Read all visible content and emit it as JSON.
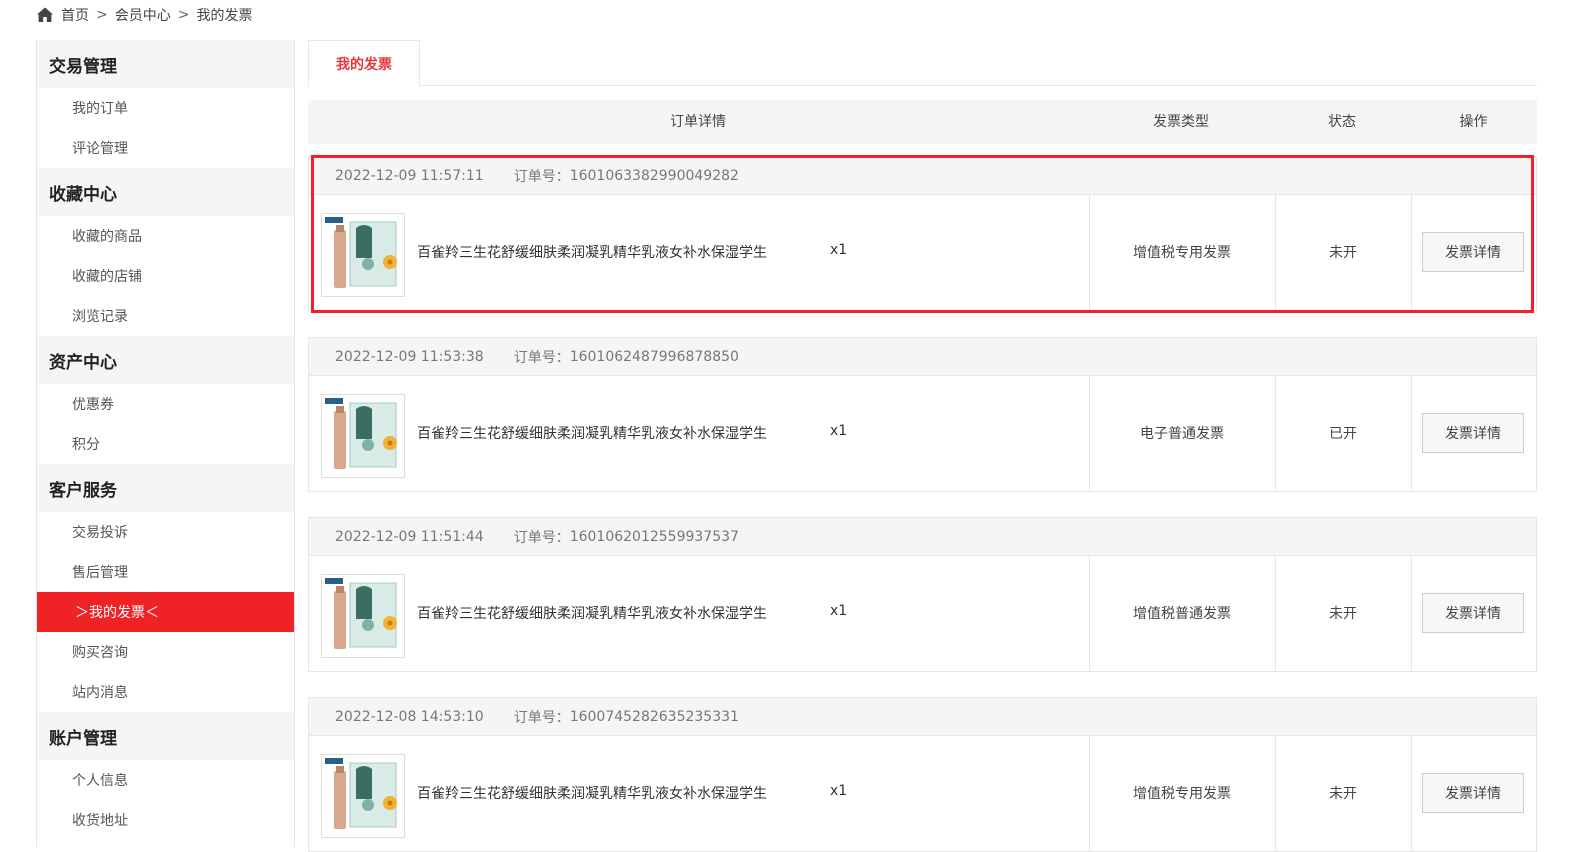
{
  "breadcrumb": {
    "home": "首页",
    "sep": ">",
    "member": "会员中心",
    "current": "我的发票"
  },
  "sidebar": {
    "groups": [
      {
        "title": "交易管理",
        "items": [
          "我的订单",
          "评论管理"
        ]
      },
      {
        "title": "收藏中心",
        "items": [
          "收藏的商品",
          "收藏的店铺",
          "浏览记录"
        ]
      },
      {
        "title": "资产中心",
        "items": [
          "优惠券",
          "积分"
        ]
      },
      {
        "title": "客户服务",
        "items": [
          "交易投诉",
          "售后管理",
          "＞我的发票＜",
          "购买咨询",
          "站内消息"
        ]
      },
      {
        "title": "账户管理",
        "items": [
          "个人信息",
          "收货地址"
        ]
      }
    ]
  },
  "tabs": {
    "active": "我的发票"
  },
  "table": {
    "headers": {
      "detail": "订单详情",
      "type": "发票类型",
      "status": "状态",
      "action": "操作"
    }
  },
  "orders": [
    {
      "date": "2022-12-09 11:57:11",
      "order_label": "订单号：",
      "order_no": "1601063382990049282",
      "product": "百雀羚三生花舒缓细肤柔润凝乳精华乳液女补水保湿学生",
      "qty": "x1",
      "invoice_type": "增值税专用发票",
      "status": "未开",
      "action": "发票详情"
    },
    {
      "date": "2022-12-09 11:53:38",
      "order_label": "订单号：",
      "order_no": "1601062487996878850",
      "product": "百雀羚三生花舒缓细肤柔润凝乳精华乳液女补水保湿学生",
      "qty": "x1",
      "invoice_type": "电子普通发票",
      "status": "已开",
      "action": "发票详情"
    },
    {
      "date": "2022-12-09 11:51:44",
      "order_label": "订单号：",
      "order_no": "1601062012559937537",
      "product": "百雀羚三生花舒缓细肤柔润凝乳精华乳液女补水保湿学生",
      "qty": "x1",
      "invoice_type": "增值税普通发票",
      "status": "未开",
      "action": "发票详情"
    },
    {
      "date": "2022-12-08 14:53:10",
      "order_label": "订单号：",
      "order_no": "1600745282635235331",
      "product": "百雀羚三生花舒缓细肤柔润凝乳精华乳液女补水保湿学生",
      "qty": "x1",
      "invoice_type": "增值税专用发票",
      "status": "未开",
      "action": "发票详情"
    }
  ],
  "colors": {
    "accent": "#ef2326",
    "tab_text": "#e4393c",
    "header_bg": "#f5f5f5",
    "border": "#e6e6e6"
  },
  "icons": {
    "home": "home-icon"
  }
}
